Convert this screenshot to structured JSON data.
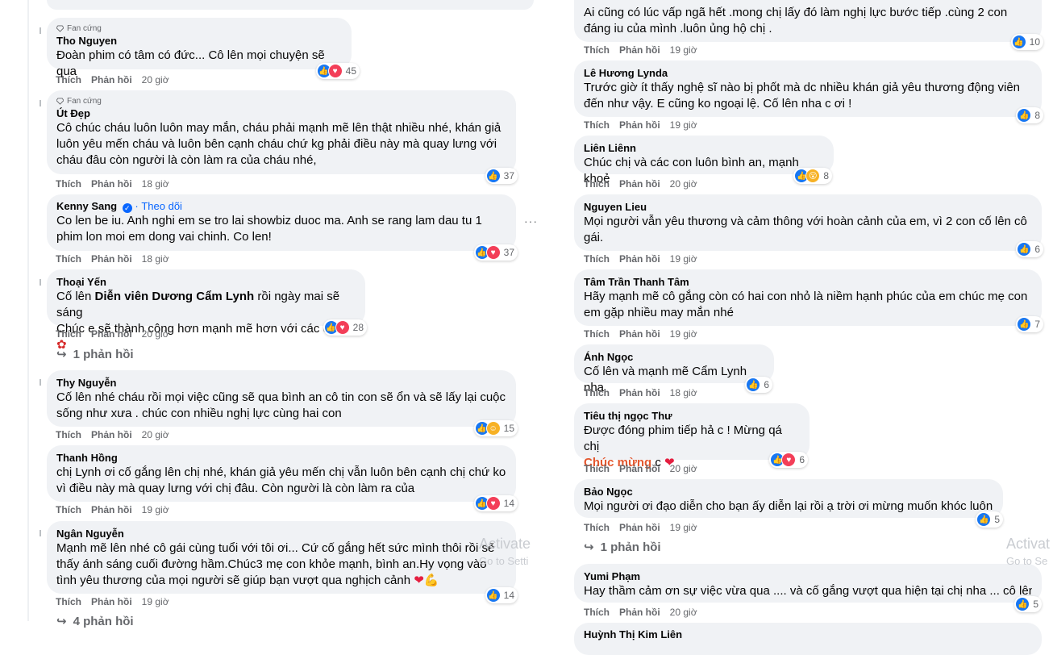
{
  "actions": {
    "like": "Thích",
    "reply": "Phản hồi"
  },
  "badge": "Fan cứng",
  "follow": "Theo dõi",
  "left": [
    {
      "author": "Tho Nguyen",
      "text": "Đoàn phim có tâm có đức... Cô lên mọi chuyện sẽ qua",
      "time": "20 giờ",
      "reacts": "45"
    },
    {
      "author": "Út Đẹp",
      "text": "Cô chúc cháu luôn luôn may mắn, cháu phải mạnh mẽ lên thật nhiều nhé, khán giả luôn yêu mến cháu và luôn bên cạnh cháu chứ kg phải điều này mà quay lưng với cháu đâu còn người là còn làm ra của cháu nhé,",
      "time": "18 giờ",
      "reacts": "37"
    },
    {
      "author": "Kenny Sang",
      "text": "Co len be iu. Anh nghi em se tro lai showbiz duoc ma. Anh se rang lam dau tu 1 phim lon moi em dong vai chinh. Co len!",
      "time": "18 giờ",
      "reacts": "37"
    },
    {
      "author": "Thoại Yến",
      "text_a": "Cố lên ",
      "mention": "Diễn viên Dương Cẩm Lynh",
      "text_b": " rồi ngày mai sẽ sáng",
      "text_c": "Chúc e sẽ thành công hơn mạnh mẽ hơn với các con",
      "time": "20 giờ",
      "reacts": "28",
      "replies": "1 phản hồi"
    },
    {
      "author": "Thy Nguyễn",
      "text": "Cố lên nhé cháu rồi mọi việc cũng sẽ qua bình an cô tin con sẽ ổn và sẽ lấy lại cuộc sống như xưa . chúc con nhiều nghị lực cùng hai con",
      "time": "20 giờ",
      "reacts": "15"
    },
    {
      "author": "Thanh Hồng",
      "text": "chị Lynh ơi cố gắng lên chị nhé, khán giả yêu mến chị vẫn luôn bên cạnh chị chứ ko vì điều này mà quay lưng với chị đâu. Còn người là còn làm ra của",
      "time": "19 giờ",
      "reacts": "14"
    },
    {
      "author": "Ngân Nguyễn",
      "text": "Mạnh mẽ lên nhé cô gái cùng tuổi với tôi ơi... Cứ cố gắng hết sức mình thôi rồi sẽ thấy ánh sáng cuối đường hầm.Chúc3 mẹ con khỏe mạnh, bình an.Hy vọng vào tình yêu thương của mọi người sẽ giúp bạn vượt qua nghịch cảnh",
      "time": "19 giờ",
      "reacts": "14",
      "replies": "4 phản hồi"
    }
  ],
  "right": [
    {
      "text": "Ai cũng có lúc vấp ngã hết .mong chị lấy đó làm nghị lực bước tiếp .cùng 2 con đáng iu của mình .luôn ủng hộ chị .",
      "time": "19 giờ",
      "reacts": "10"
    },
    {
      "author": "Lê Hương Lynda",
      "text": "Trước giờ ít thấy nghệ sĩ nào bị phốt mà dc nhiều khán giả yêu thương động viên đến như vậy. E cũng ko ngoại lệ. Cố lên nha c ơi !",
      "time": "19 giờ",
      "reacts": "8"
    },
    {
      "author": "Liên Liênn",
      "text": "Chúc chị và các con luôn bình an, mạnh khoẻ",
      "time": "20 giờ",
      "reacts": "8"
    },
    {
      "author": "Nguyen Lieu",
      "text": "Mọi người vẫn yêu thương và cảm thông với hoàn cảnh của em, vì 2 con cố lên cô gái.",
      "time": "19 giờ",
      "reacts": "6"
    },
    {
      "author": "Tâm Trần Thanh Tâm",
      "text": "Hãy mạnh mẽ cô gắng còn có hai con nhỏ là niềm hạnh phúc của em chúc mẹ con em gặp nhiều may mắn nhé",
      "time": "19 giờ",
      "reacts": "7"
    },
    {
      "author": "Ánh Ngọc",
      "text": "Cố lên và mạnh mẽ Cẩm Lynh nha",
      "time": "18 giờ",
      "reacts": "6"
    },
    {
      "author": "Tiêu thị ngọc Thư",
      "text": "Được đóng phim tiếp hả c ! Mừng qá chị",
      "hl": "Chúc mừng",
      "text_b": " c",
      "time": "20 giờ",
      "reacts": "6"
    },
    {
      "author": "Bảo Ngọc",
      "text": "Mọi người ơi đạo diễn cho bạn ấy diễn lại rồi ạ trời ơi mừng muốn khóc luôn",
      "time": "19 giờ",
      "reacts": "5",
      "replies": "1 phản hồi"
    },
    {
      "author": "Yumi Phạm",
      "text": "Hay thầm cảm ơn sự việc vừa qua .... và cố gắng vượt qua hiện tại chị nha ... cô lên ...",
      "time": "20 giờ",
      "reacts": "5"
    },
    {
      "author": "Huỳnh Thị Kim Liên"
    }
  ],
  "watermark": {
    "title": "Activate",
    "sub": "Go to Setti",
    "title2": "Activat",
    "sub2": "Go to Se"
  },
  "more": "···"
}
